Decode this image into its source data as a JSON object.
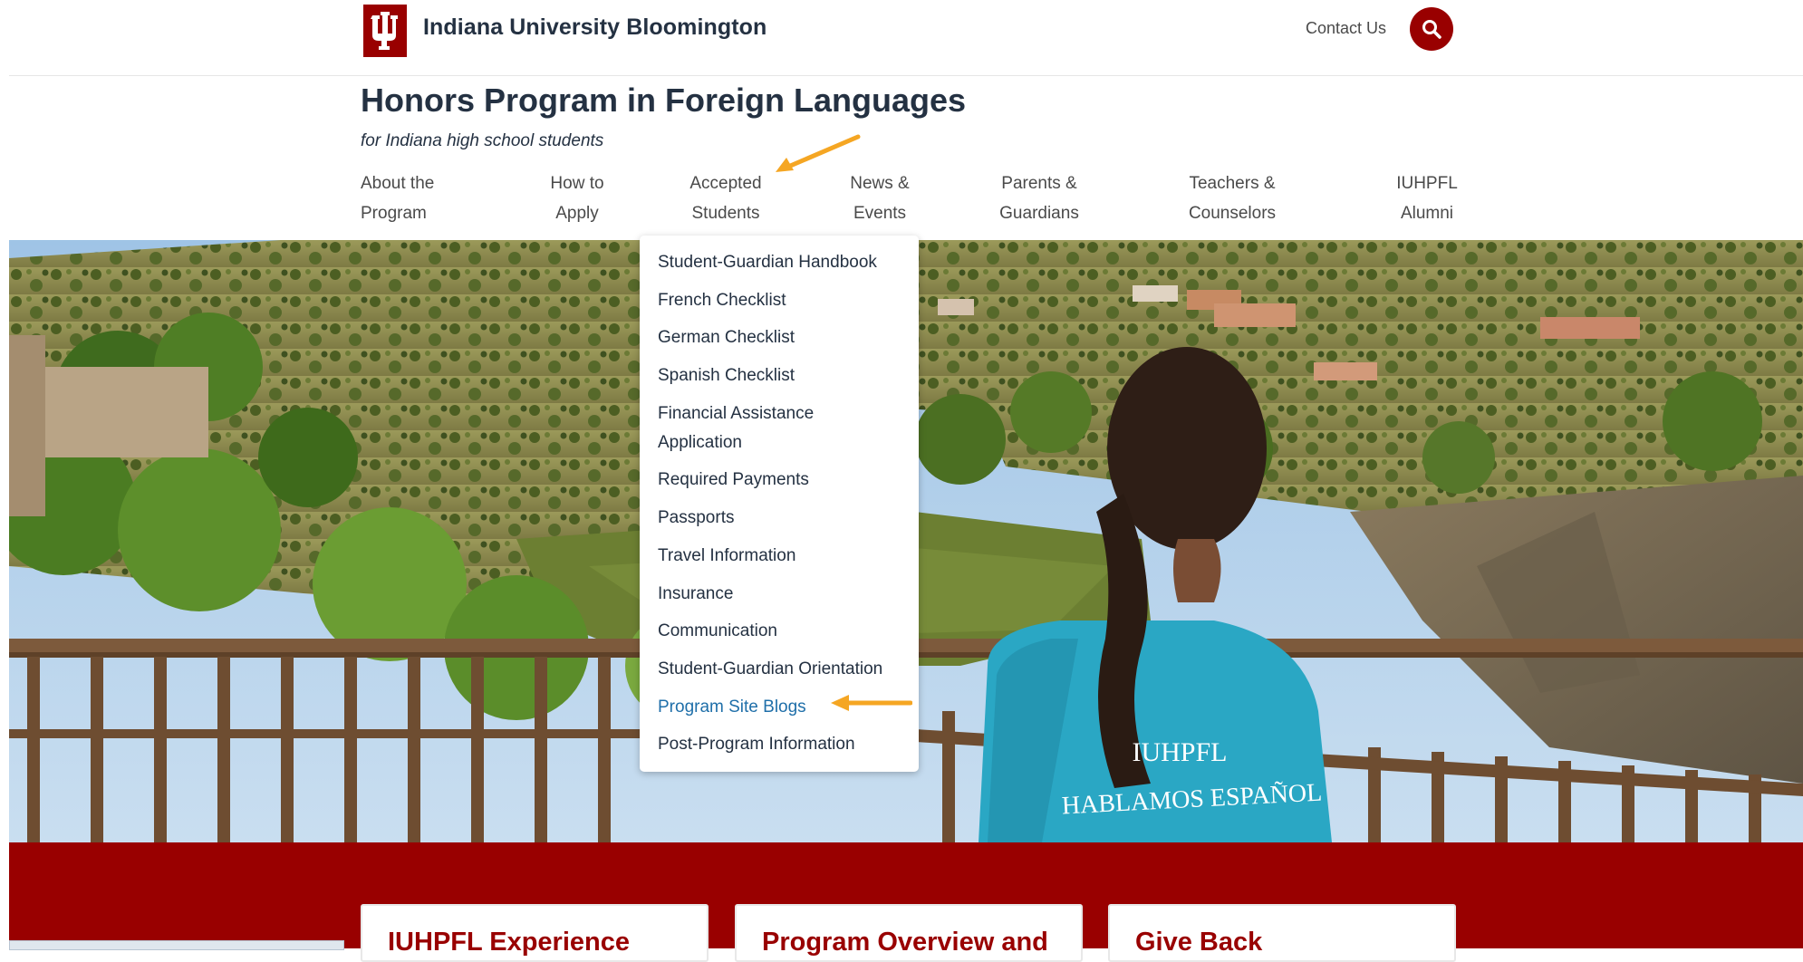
{
  "header": {
    "brand": "Indiana University Bloomington",
    "contact_label": "Contact Us"
  },
  "site": {
    "title": "Honors Program in Foreign Languages",
    "subtitle": "for Indiana high school students"
  },
  "nav": [
    {
      "line1": "About the",
      "line2": "Program"
    },
    {
      "line1": "How to",
      "line2": "Apply"
    },
    {
      "line1": "Accepted",
      "line2": "Students"
    },
    {
      "line1": "News &",
      "line2": "Events"
    },
    {
      "line1": "Parents &",
      "line2": "Guardians"
    },
    {
      "line1": "Teachers &",
      "line2": "Counselors"
    },
    {
      "line1": "IUHPFL",
      "line2": "Alumni"
    }
  ],
  "dropdown": {
    "items": [
      {
        "label": "Student-Guardian Handbook"
      },
      {
        "label": "French Checklist"
      },
      {
        "label": "German Checklist"
      },
      {
        "label": "Spanish Checklist"
      },
      {
        "label": "Financial Assistance"
      },
      {
        "label": "Application"
      },
      {
        "label": "Required Payments"
      },
      {
        "label": "Passports"
      },
      {
        "label": "Travel Information"
      },
      {
        "label": "Insurance"
      },
      {
        "label": "Communication"
      },
      {
        "label": "Student-Guardian Orientation"
      },
      {
        "label": "Program Site Blogs"
      },
      {
        "label": "Post-Program Information"
      }
    ],
    "active_item": "Program Site Blogs"
  },
  "hero": {
    "shirt_line1": "IUHPFL",
    "shirt_line2": "HABLAMOS ESPAÑOL"
  },
  "cards": [
    {
      "title": "IUHPFL Experience"
    },
    {
      "title": "Program Overview and"
    },
    {
      "title": "Give Back"
    }
  ],
  "colors": {
    "brand_crimson": "#990000",
    "annotation_arrow": "#f5a623",
    "link_active": "#1f6fa9"
  }
}
